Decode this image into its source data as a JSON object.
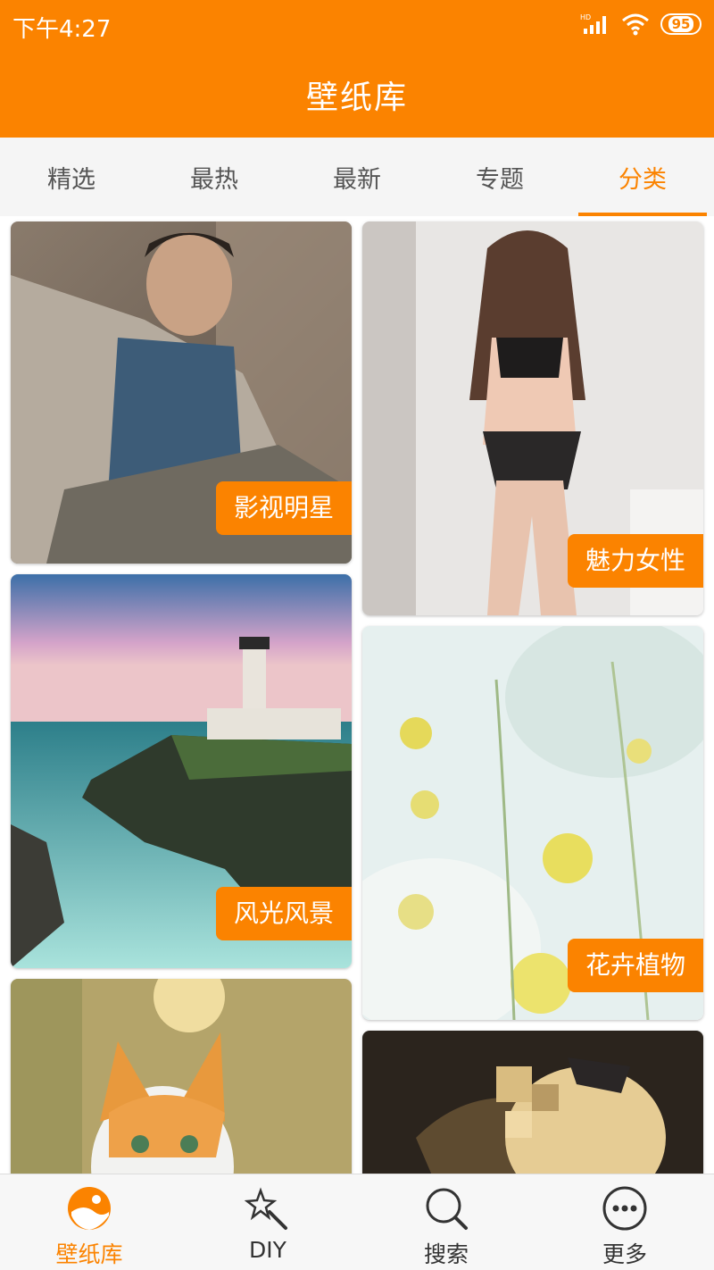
{
  "status_bar": {
    "time": "下午4:27",
    "network": "HD",
    "battery": "95",
    "icons": [
      "signal-icon",
      "wifi-icon",
      "battery-icon"
    ]
  },
  "header": {
    "title": "壁纸库"
  },
  "tabs": [
    {
      "label": "精选",
      "active": false
    },
    {
      "label": "最热",
      "active": false
    },
    {
      "label": "最新",
      "active": false
    },
    {
      "label": "专题",
      "active": false
    },
    {
      "label": "分类",
      "active": true
    }
  ],
  "categories": [
    {
      "label": "影视明星",
      "image": "portrait of a man reclining"
    },
    {
      "label": "魅力女性",
      "image": "woman posing against white wall"
    },
    {
      "label": "风光风景",
      "image": "lighthouse on coastal cliff at sunset"
    },
    {
      "label": "花卉植物",
      "image": "soft focus chamomile flowers"
    },
    {
      "label": "",
      "image": "orange and white kitten"
    },
    {
      "label": "",
      "image": "illustrated blonde character on dark background"
    }
  ],
  "bottom_nav": [
    {
      "label": "壁纸库",
      "icon": "wallpaper-library-icon",
      "active": true
    },
    {
      "label": "DIY",
      "icon": "magic-wand-icon",
      "active": false
    },
    {
      "label": "搜索",
      "icon": "search-icon",
      "active": false
    },
    {
      "label": "更多",
      "icon": "more-icon",
      "active": false
    }
  ],
  "colors": {
    "accent": "#fb8300",
    "background": "#f2f2f2"
  }
}
